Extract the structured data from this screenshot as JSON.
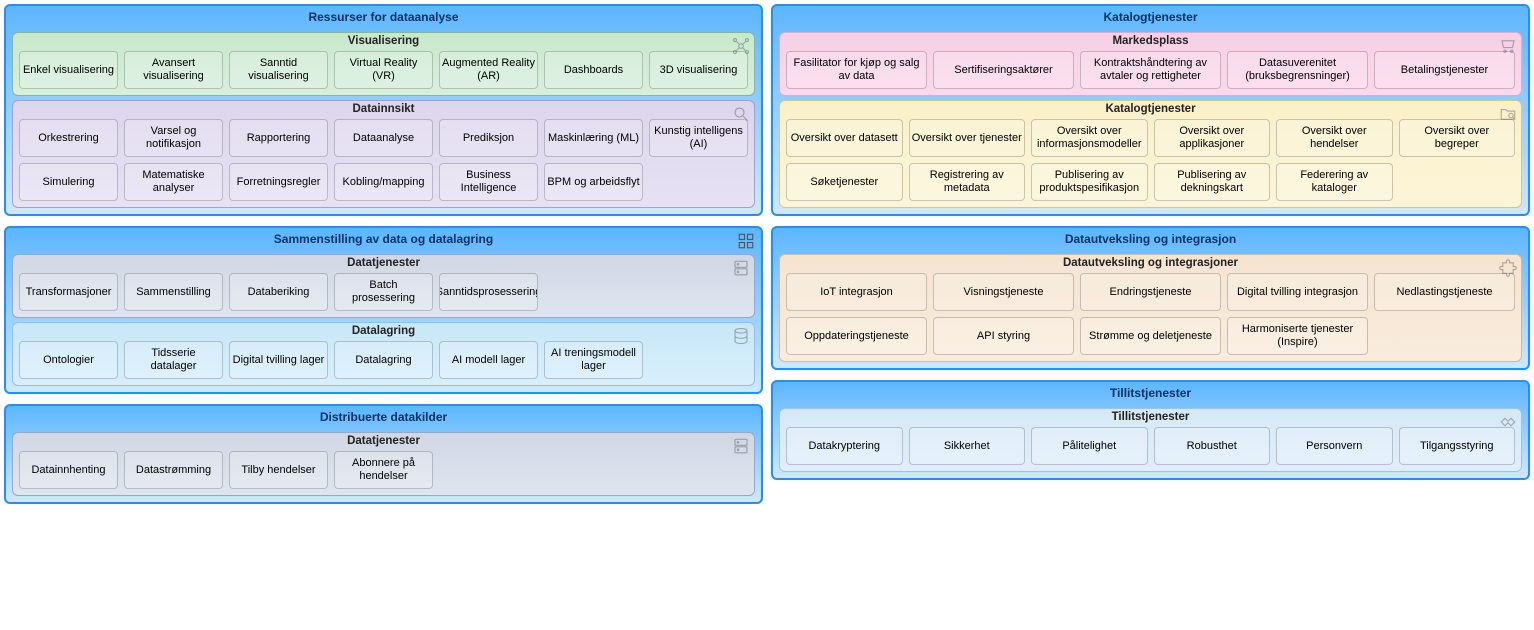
{
  "left": [
    {
      "title": "Ressurser for dataanalyse",
      "sections": [
        {
          "title": "Visualisering",
          "theme": "sec-green",
          "icon": "network-icon",
          "cols": 7,
          "rows": [
            [
              "Enkel visualisering",
              "Avansert visualisering",
              "Sanntid visualisering",
              "Virtual Reality (VR)",
              "Augmented Reality (AR)",
              "Dashboards",
              "3D visualisering"
            ]
          ]
        },
        {
          "title": "Datainnsikt",
          "theme": "sec-purple",
          "icon": "magnifier-icon",
          "cols": 7,
          "rows": [
            [
              "Orkestrering",
              "Varsel og notifikasjon",
              "Rapportering",
              "Dataanalyse",
              "Prediksjon",
              "Maskinlæring (ML)",
              "Kunstig intelligens (AI)"
            ],
            [
              "Simulering",
              "Matematiske analyser",
              "Forretningsregler",
              "Kobling/mapping",
              "Business Intelligence",
              "BPM og arbeidsflyt"
            ]
          ]
        }
      ]
    },
    {
      "title": "Sammenstilling av data og datalagring",
      "icon": "grid-icon",
      "sections": [
        {
          "title": "Datatjenester",
          "theme": "sec-grayblue",
          "icon": "servers-icon",
          "cols": 7,
          "rows": [
            [
              "Transformasjoner",
              "Sammenstilling",
              "Databeriking",
              "Batch prosessering",
              "Sanntidsprosessering"
            ]
          ]
        },
        {
          "title": "Datalagring",
          "theme": "sec-lightblue",
          "icon": "database-icon",
          "cols": 7,
          "rows": [
            [
              "Ontologier",
              "Tidsserie datalager",
              "Digital tvilling lager",
              "Datalagring",
              "AI modell lager",
              "AI treningsmodell lager"
            ]
          ]
        }
      ]
    },
    {
      "title": "Distribuerte datakilder",
      "sections": [
        {
          "title": "Datatjenester",
          "theme": "sec-grayblue",
          "icon": "servers-icon",
          "cols": 7,
          "rows": [
            [
              "Datainnhenting",
              "Datastrømming",
              "Tilby hendelser",
              "Abonnere på hendelser"
            ]
          ]
        }
      ]
    }
  ],
  "right": [
    {
      "title": "Katalogtjenester",
      "sections": [
        {
          "title": "Markedsplass",
          "theme": "sec-pink",
          "icon": "cart-icon",
          "cols": 5,
          "rows": [
            [
              "Fasilitator for kjøp og salg av data",
              "Sertifiseringsaktører",
              "Kontraktshåndtering av avtaler og rettigheter",
              "Datasuverenitet (bruksbegrensninger)",
              "Betalingstjenester"
            ]
          ]
        },
        {
          "title": "Katalogtjenester",
          "theme": "sec-yellow",
          "icon": "folder-search-icon",
          "cols": 6,
          "rows": [
            [
              "Oversikt over datasett",
              "Oversikt over tjenester",
              "Oversikt over informasjonsmodeller",
              "Oversikt over applikasjoner",
              "Oversikt over hendelser",
              "Oversikt over begreper"
            ],
            [
              "Søketjenester",
              "Registrering av metadata",
              "Publisering av produktspesifikasjon",
              "Publisering av dekningskart",
              "Federering av kataloger"
            ]
          ]
        }
      ]
    },
    {
      "title": "Datautveksling og integrasjon",
      "sections": [
        {
          "title": "Datautveksling og integrasjoner",
          "theme": "sec-tan",
          "icon": "puzzle-icon",
          "cols": 5,
          "rows": [
            [
              "IoT integrasjon",
              "Visningstjeneste",
              "Endringstjeneste",
              "Digital tvilling integrasjon",
              "Nedlastingstjeneste"
            ],
            [
              "Oppdateringstjeneste",
              "API styring",
              "Strømme og deletjeneste",
              "Harmoniserte tjenester (Inspire)"
            ]
          ]
        }
      ]
    },
    {
      "title": "Tillitstjenester",
      "sections": [
        {
          "title": "Tillitstjenester",
          "theme": "sec-paleblue",
          "icon": "handshake-icon",
          "cols": 6,
          "rows": [
            [
              "Datakryptering",
              "Sikkerhet",
              "Pålitelighet",
              "Robusthet",
              "Personvern",
              "Tilgangsstyring"
            ]
          ]
        }
      ]
    }
  ]
}
